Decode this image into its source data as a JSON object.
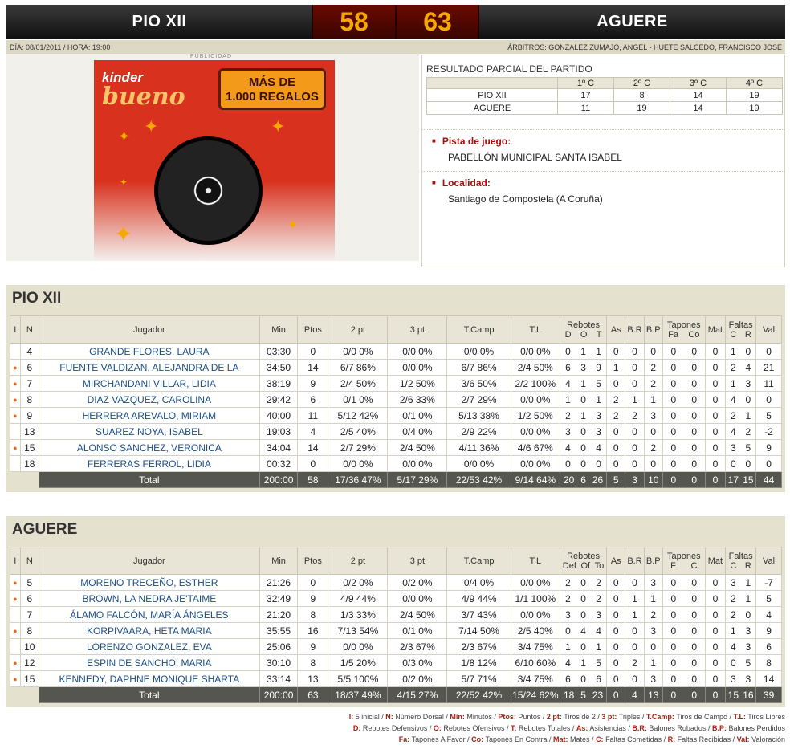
{
  "header": {
    "home": "PIO XII",
    "home_score": "58",
    "away_score": "63",
    "away": "AGUERE"
  },
  "info": {
    "date": "DÍA: 08/01/2011 / HORA: 19:00",
    "referees": "ÁRBITROS: GONZALEZ ZUMAJO, ANGEL - HUETE SALCEDO, FRANCISCO JOSE"
  },
  "ad": {
    "label": "PUBLICIDAD",
    "brand1": "kinder",
    "brand2": "bueno",
    "promo1": "MÁS DE",
    "promo2": "1.000 REGALOS"
  },
  "partial": {
    "title": "RESULTADO PARCIAL DEL PARTIDO",
    "quarters": [
      "1º C",
      "2º C",
      "3º C",
      "4º C"
    ],
    "rows": [
      {
        "team": "PIO XII",
        "q": [
          "17",
          "8",
          "14",
          "19"
        ]
      },
      {
        "team": "AGUERE",
        "q": [
          "11",
          "19",
          "14",
          "19"
        ]
      }
    ]
  },
  "venue": {
    "label": "Pista de juego:",
    "value": "PABELLÓN MUNICIPAL SANTA ISABEL"
  },
  "locality": {
    "label": "Localidad:",
    "value": "Santiago de Compostela (A Coruña)"
  },
  "teams": [
    {
      "name": "PIO XII",
      "headers": {
        "i": "I",
        "n": "N",
        "player": "Jugador",
        "min": "Min",
        "pts": "Ptos",
        "p2": "2 pt",
        "p3": "3 pt",
        "tc": "T.Camp",
        "tl": "T.L",
        "reb": "Rebotes",
        "reb_sub": [
          "D",
          "O",
          "T"
        ],
        "as": "As",
        "br": "B.R",
        "bp": "B.P",
        "tap": "Tapones",
        "tap_sub": [
          "Fa",
          "Co"
        ],
        "mat": "Mat",
        "faltas": "Faltas",
        "faltas_sub": [
          "C",
          "R"
        ],
        "val": "Val"
      },
      "players": [
        {
          "i": "",
          "n": "4",
          "name": "GRANDE FLORES, LAURA",
          "min": "03:30",
          "pts": "0",
          "p2": "0/0 0%",
          "p3": "0/0 0%",
          "tc": "0/0 0%",
          "tl": "0/0 0%",
          "reb": [
            "0",
            "1",
            "1"
          ],
          "as": "0",
          "br": "0",
          "bp": "0",
          "tap": [
            "0",
            "0"
          ],
          "mat": "0",
          "faltas": [
            "1",
            "0"
          ],
          "val": "0"
        },
        {
          "i": "●",
          "n": "6",
          "name": "FUENTE VALDIZAN, ALEJANDRA DE LA",
          "min": "34:50",
          "pts": "14",
          "p2": "6/7 86%",
          "p3": "0/0 0%",
          "tc": "6/7 86%",
          "tl": "2/4 50%",
          "reb": [
            "6",
            "3",
            "9"
          ],
          "as": "1",
          "br": "0",
          "bp": "2",
          "tap": [
            "0",
            "0"
          ],
          "mat": "0",
          "faltas": [
            "2",
            "4"
          ],
          "val": "21"
        },
        {
          "i": "●",
          "n": "7",
          "name": "MIRCHANDANI VILLAR, LIDIA",
          "min": "38:19",
          "pts": "9",
          "p2": "2/4 50%",
          "p3": "1/2 50%",
          "tc": "3/6 50%",
          "tl": "2/2 100%",
          "reb": [
            "4",
            "1",
            "5"
          ],
          "as": "0",
          "br": "0",
          "bp": "2",
          "tap": [
            "0",
            "0"
          ],
          "mat": "0",
          "faltas": [
            "1",
            "3"
          ],
          "val": "11"
        },
        {
          "i": "●",
          "n": "8",
          "name": "DIAZ VAZQUEZ, CAROLINA",
          "min": "29:42",
          "pts": "6",
          "p2": "0/1 0%",
          "p3": "2/6 33%",
          "tc": "2/7 29%",
          "tl": "0/0 0%",
          "reb": [
            "1",
            "0",
            "1"
          ],
          "as": "2",
          "br": "1",
          "bp": "1",
          "tap": [
            "0",
            "0"
          ],
          "mat": "0",
          "faltas": [
            "4",
            "0"
          ],
          "val": "0"
        },
        {
          "i": "●",
          "n": "9",
          "name": "HERRERA AREVALO, MIRIAM",
          "min": "40:00",
          "pts": "11",
          "p2": "5/12 42%",
          "p3": "0/1 0%",
          "tc": "5/13 38%",
          "tl": "1/2 50%",
          "reb": [
            "2",
            "1",
            "3"
          ],
          "as": "2",
          "br": "2",
          "bp": "3",
          "tap": [
            "0",
            "0"
          ],
          "mat": "0",
          "faltas": [
            "2",
            "1"
          ],
          "val": "5"
        },
        {
          "i": "",
          "n": "13",
          "name": "SUAREZ NOYA, ISABEL",
          "min": "19:03",
          "pts": "4",
          "p2": "2/5 40%",
          "p3": "0/4 0%",
          "tc": "2/9 22%",
          "tl": "0/0 0%",
          "reb": [
            "3",
            "0",
            "3"
          ],
          "as": "0",
          "br": "0",
          "bp": "0",
          "tap": [
            "0",
            "0"
          ],
          "mat": "0",
          "faltas": [
            "4",
            "2"
          ],
          "val": "-2"
        },
        {
          "i": "●",
          "n": "15",
          "name": "ALONSO SANCHEZ, VERONICA",
          "min": "34:04",
          "pts": "14",
          "p2": "2/7 29%",
          "p3": "2/4 50%",
          "tc": "4/11 36%",
          "tl": "4/6 67%",
          "reb": [
            "4",
            "0",
            "4"
          ],
          "as": "0",
          "br": "0",
          "bp": "2",
          "tap": [
            "0",
            "0"
          ],
          "mat": "0",
          "faltas": [
            "3",
            "5"
          ],
          "val": "9"
        },
        {
          "i": "",
          "n": "18",
          "name": "FERRERAS FERROL, LIDIA",
          "min": "00:32",
          "pts": "0",
          "p2": "0/0 0%",
          "p3": "0/0 0%",
          "tc": "0/0 0%",
          "tl": "0/0 0%",
          "reb": [
            "0",
            "0",
            "0"
          ],
          "as": "0",
          "br": "0",
          "bp": "0",
          "tap": [
            "0",
            "0"
          ],
          "mat": "0",
          "faltas": [
            "0",
            "0"
          ],
          "val": "0"
        }
      ],
      "total": {
        "label": "Total",
        "min": "200:00",
        "pts": "58",
        "p2": "17/36 47%",
        "p3": "5/17 29%",
        "tc": "22/53 42%",
        "tl": "9/14 64%",
        "reb": [
          "20",
          "6",
          "26"
        ],
        "as": "5",
        "br": "3",
        "bp": "10",
        "tap": [
          "0",
          "0"
        ],
        "mat": "0",
        "faltas": [
          "17",
          "15"
        ],
        "val": "44"
      }
    },
    {
      "name": "AGUERE",
      "headers": {
        "i": "I",
        "n": "N",
        "player": "Jugador",
        "min": "Min",
        "pts": "Ptos",
        "p2": "2 pt",
        "p3": "3 pt",
        "tc": "T.Camp",
        "tl": "T.L",
        "reb": "Rebotes",
        "reb_sub": [
          "Def",
          "Of",
          "To"
        ],
        "as": "As",
        "br": "B.R",
        "bp": "B.P",
        "tap": "Tapones",
        "tap_sub": [
          "F",
          "C"
        ],
        "mat": "Mat",
        "faltas": "Faltas",
        "faltas_sub": [
          "C",
          "R"
        ],
        "val": "Val"
      },
      "players": [
        {
          "i": "●",
          "n": "5",
          "name": "MORENO TRECEÑO, ESTHER",
          "min": "21:26",
          "pts": "0",
          "p2": "0/2 0%",
          "p3": "0/2 0%",
          "tc": "0/4 0%",
          "tl": "0/0 0%",
          "reb": [
            "2",
            "0",
            "2"
          ],
          "as": "0",
          "br": "0",
          "bp": "3",
          "tap": [
            "0",
            "0"
          ],
          "mat": "0",
          "faltas": [
            "3",
            "1"
          ],
          "val": "-7"
        },
        {
          "i": "●",
          "n": "6",
          "name": "BROWN, LA NEDRA JE'TAIME",
          "min": "32:49",
          "pts": "9",
          "p2": "4/9 44%",
          "p3": "0/0 0%",
          "tc": "4/9 44%",
          "tl": "1/1 100%",
          "reb": [
            "2",
            "0",
            "2"
          ],
          "as": "0",
          "br": "1",
          "bp": "1",
          "tap": [
            "0",
            "0"
          ],
          "mat": "0",
          "faltas": [
            "2",
            "1"
          ],
          "val": "5"
        },
        {
          "i": "",
          "n": "7",
          "name": "ÁLAMO FALCÓN, MARÍA ÁNGELES",
          "min": "21:20",
          "pts": "8",
          "p2": "1/3 33%",
          "p3": "2/4 50%",
          "tc": "3/7 43%",
          "tl": "0/0 0%",
          "reb": [
            "3",
            "0",
            "3"
          ],
          "as": "0",
          "br": "1",
          "bp": "2",
          "tap": [
            "0",
            "0"
          ],
          "mat": "0",
          "faltas": [
            "2",
            "0"
          ],
          "val": "4"
        },
        {
          "i": "●",
          "n": "8",
          "name": "KORPIVAARA, HETA MARIA",
          "min": "35:55",
          "pts": "16",
          "p2": "7/13 54%",
          "p3": "0/1 0%",
          "tc": "7/14 50%",
          "tl": "2/5 40%",
          "reb": [
            "0",
            "4",
            "4"
          ],
          "as": "0",
          "br": "0",
          "bp": "3",
          "tap": [
            "0",
            "0"
          ],
          "mat": "0",
          "faltas": [
            "1",
            "3"
          ],
          "val": "9"
        },
        {
          "i": "",
          "n": "10",
          "name": "LORENZO GONZALEZ, EVA",
          "min": "25:06",
          "pts": "9",
          "p2": "0/0 0%",
          "p3": "2/3 67%",
          "tc": "2/3 67%",
          "tl": "3/4 75%",
          "reb": [
            "1",
            "0",
            "1"
          ],
          "as": "0",
          "br": "0",
          "bp": "0",
          "tap": [
            "0",
            "0"
          ],
          "mat": "0",
          "faltas": [
            "4",
            "3"
          ],
          "val": "6"
        },
        {
          "i": "●",
          "n": "12",
          "name": "ESPIN DE SANCHO, MARIA",
          "min": "30:10",
          "pts": "8",
          "p2": "1/5 20%",
          "p3": "0/3 0%",
          "tc": "1/8 12%",
          "tl": "6/10 60%",
          "reb": [
            "4",
            "1",
            "5"
          ],
          "as": "0",
          "br": "2",
          "bp": "1",
          "tap": [
            "0",
            "0"
          ],
          "mat": "0",
          "faltas": [
            "0",
            "5"
          ],
          "val": "8"
        },
        {
          "i": "●",
          "n": "15",
          "name": "KENNEDY, DAPHNE MONIQUE SHARTA",
          "min": "33:14",
          "pts": "13",
          "p2": "5/5 100%",
          "p3": "0/2 0%",
          "tc": "5/7 71%",
          "tl": "3/4 75%",
          "reb": [
            "6",
            "0",
            "6"
          ],
          "as": "0",
          "br": "0",
          "bp": "3",
          "tap": [
            "0",
            "0"
          ],
          "mat": "0",
          "faltas": [
            "3",
            "3"
          ],
          "val": "14"
        }
      ],
      "total": {
        "label": "Total",
        "min": "200:00",
        "pts": "63",
        "p2": "18/37 49%",
        "p3": "4/15 27%",
        "tc": "22/52 42%",
        "tl": "15/24 62%",
        "reb": [
          "18",
          "5",
          "23"
        ],
        "as": "0",
        "br": "4",
        "bp": "13",
        "tap": [
          "0",
          "0"
        ],
        "mat": "0",
        "faltas": [
          "15",
          "16"
        ],
        "val": "39"
      }
    }
  ],
  "legend": [
    [
      [
        "I:",
        " 5 inicial / "
      ],
      [
        "N:",
        " Número Dorsal / "
      ],
      [
        "Min:",
        " Minutos / "
      ],
      [
        "Ptos:",
        " Puntos / "
      ],
      [
        "2 pt:",
        " Tiros de 2 / "
      ],
      [
        "3 pt:",
        " Triples / "
      ],
      [
        "T.Camp:",
        " Tiros de Campo / "
      ],
      [
        "T.L:",
        " Tiros Libres"
      ]
    ],
    [
      [
        "D:",
        " Rebotes Defensivos / "
      ],
      [
        "O:",
        " Rebotes Ofensivos / "
      ],
      [
        "T:",
        " Rebotes Totales / "
      ],
      [
        "As:",
        " Asistencias / "
      ],
      [
        "B.R:",
        " Balones Robados / "
      ],
      [
        "B.P:",
        " Balones Perdidos"
      ]
    ],
    [
      [
        "Fa:",
        " Tapones A Favor / "
      ],
      [
        "Co:",
        " Tapones En Contra / "
      ],
      [
        "Mat:",
        " Mates / "
      ],
      [
        "C:",
        " Faltas Cometidas / "
      ],
      [
        "R:",
        " Faltas Recibidas / "
      ],
      [
        "Val:",
        " Valoración"
      ]
    ]
  ],
  "colors": {
    "accent": "#f6a800",
    "header_bg": "#111111",
    "panel_bg": "#e4e1cf",
    "link": "#1c4f86",
    "legend_key": "#b01e12"
  }
}
